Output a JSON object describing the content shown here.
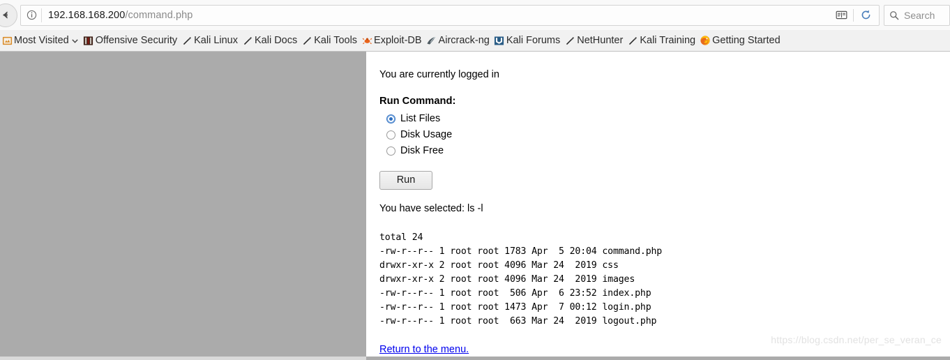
{
  "browser": {
    "back_button": "Back",
    "url_host": "192.168.168.200",
    "url_path": "/command.php",
    "reader_view_label": "Reader View",
    "reload_label": "Reload",
    "search_placeholder": "Search",
    "bookmarks": [
      {
        "label": "Most Visited",
        "icon": "bookmark-folder-icon",
        "has_chevron": true
      },
      {
        "label": "Offensive Security",
        "icon": "offensive-security-icon",
        "has_chevron": false
      },
      {
        "label": "Kali Linux",
        "icon": "kali-dragon-icon",
        "has_chevron": false
      },
      {
        "label": "Kali Docs",
        "icon": "kali-dragon-icon",
        "has_chevron": false
      },
      {
        "label": "Kali Tools",
        "icon": "kali-dragon-icon",
        "has_chevron": false
      },
      {
        "label": "Exploit-DB",
        "icon": "exploit-db-icon",
        "has_chevron": false
      },
      {
        "label": "Aircrack-ng",
        "icon": "aircrack-ng-icon",
        "has_chevron": false
      },
      {
        "label": "Kali Forums",
        "icon": "kali-forums-icon",
        "has_chevron": false
      },
      {
        "label": "NetHunter",
        "icon": "kali-dragon-icon",
        "has_chevron": false
      },
      {
        "label": "Kali Training",
        "icon": "kali-dragon-icon",
        "has_chevron": false
      },
      {
        "label": "Getting Started",
        "icon": "firefox-icon",
        "has_chevron": false
      }
    ]
  },
  "page": {
    "logged_in_message": "You are currently logged in",
    "run_command_heading": "Run Command:",
    "options": [
      {
        "label": "List Files",
        "selected": true
      },
      {
        "label": "Disk Usage",
        "selected": false
      },
      {
        "label": "Disk Free",
        "selected": false
      }
    ],
    "run_button_label": "Run",
    "selected_message": "You have selected: ls -l",
    "command_output": "total 24\n-rw-r--r-- 1 root root 1783 Apr  5 20:04 command.php\ndrwxr-xr-x 2 root root 4096 Mar 24  2019 css\ndrwxr-xr-x 2 root root 4096 Mar 24  2019 images\n-rw-r--r-- 1 root root  506 Apr  6 23:52 index.php\n-rw-r--r-- 1 root root 1473 Apr  7 00:12 login.php\n-rw-r--r-- 1 root root  663 Mar 24  2019 logout.php",
    "return_link": "Return to the menu.",
    "watermark": "https://blog.csdn.net/per_se_veran_ce"
  }
}
